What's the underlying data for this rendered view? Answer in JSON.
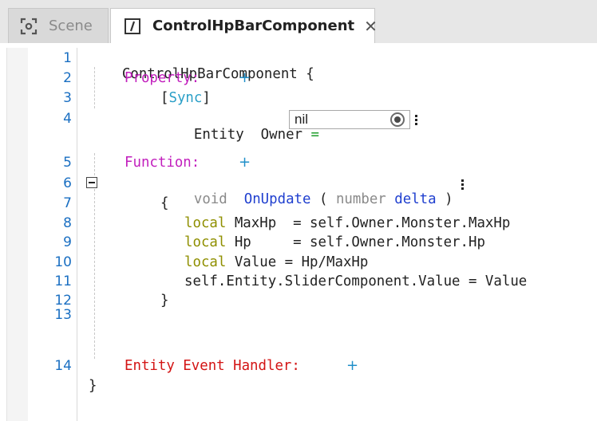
{
  "tabs": [
    {
      "label": "Scene",
      "icon": "scene-icon",
      "active": false
    },
    {
      "label": "ControlHpBarComponent",
      "icon": "script-file-icon",
      "active": true,
      "close": "✕"
    }
  ],
  "editor": {
    "line_numbers": [
      "1",
      "2",
      "3",
      "4",
      "5",
      "6",
      "7",
      "8",
      "9",
      "10",
      "11",
      "12",
      "13",
      "14"
    ],
    "header": {
      "name": "ControlHpBarComponent",
      "brace": "{"
    },
    "property_label": "Property:",
    "add_symbol": "+",
    "sync_open": "[",
    "sync_text": "Sync",
    "sync_close": "]",
    "property": {
      "type": "Entity",
      "name": "Owner",
      "eq": "=",
      "value": "nil"
    },
    "function_label": "Function:",
    "function": {
      "return_type": "void",
      "name": "OnUpdate",
      "paren_open": "(",
      "param_type": "number",
      "param_name": "delta",
      "paren_close": ")"
    },
    "body_open": "{",
    "body_lines": [
      {
        "kw": "local",
        "rest": " MaxHp  = self.Owner.Monster.MaxHp"
      },
      {
        "kw": "local",
        "rest": " Hp     = self.Owner.Monster.Hp"
      },
      {
        "kw": "local",
        "rest": " Value = Hp/MaxHp"
      },
      {
        "kw": "",
        "rest": "self.Entity.SliderComponent.Value = Value"
      }
    ],
    "body_close": "}",
    "event_label": "Entity Event Handler:",
    "end_brace": "}"
  },
  "colors": {
    "line_number": "#1a6fc2",
    "property_label": "#c21fbd",
    "event_label": "#d31414",
    "local_keyword": "#8f8f00",
    "function_name": "#1f3fcf",
    "add_button": "#1f8fc9"
  }
}
